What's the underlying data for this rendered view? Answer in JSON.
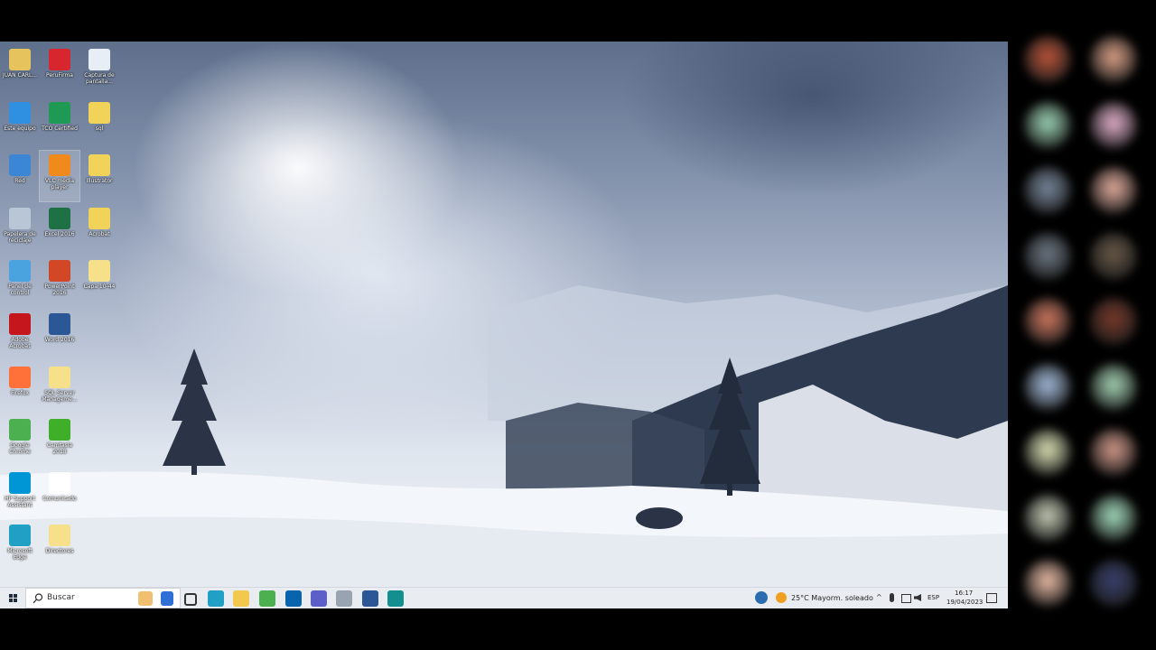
{
  "desktop": {
    "icons": [
      {
        "label": "JUAN CARL...",
        "icon": "user-folder-icon",
        "color": "#e6c35c"
      },
      {
        "label": "PeruFirma",
        "icon": "perufirma-icon",
        "color": "#d7262e"
      },
      {
        "label": "Captura de pantalla...",
        "icon": "screenshot-file-icon",
        "color": "#e8eef5"
      },
      {
        "label": "Este equipo",
        "icon": "this-pc-icon",
        "color": "#2f8fe0"
      },
      {
        "label": "TCO Certified",
        "icon": "tco-certified-icon",
        "color": "#1f9a55"
      },
      {
        "label": "sql",
        "icon": "archive-icon",
        "color": "#f2d35a"
      },
      {
        "label": "Red",
        "icon": "network-icon",
        "color": "#3c86d6"
      },
      {
        "label": "VLC media player",
        "icon": "vlc-icon",
        "color": "#f08a1c"
      },
      {
        "label": "Illustrator",
        "icon": "archive-icon",
        "color": "#f2d35a"
      },
      {
        "label": "Papelera de reciclaje",
        "icon": "recycle-bin-icon",
        "color": "#b9c6d6"
      },
      {
        "label": "Excel 2016",
        "icon": "excel-icon",
        "color": "#1e7145"
      },
      {
        "label": "Acrobat",
        "icon": "archive-icon",
        "color": "#f2d35a"
      },
      {
        "label": "Panel de control",
        "icon": "control-panel-icon",
        "color": "#4aa3df"
      },
      {
        "label": "PowerPoint 2016",
        "icon": "powerpoint-icon",
        "color": "#d24726"
      },
      {
        "label": "Capa 10-44",
        "icon": "folder-icon",
        "color": "#f7e08a"
      },
      {
        "label": "Adobe Acrobat",
        "icon": "acrobat-icon",
        "color": "#c4161c"
      },
      {
        "label": "Word 2016",
        "icon": "word-icon",
        "color": "#2b5797"
      },
      {
        "label": "Firefox",
        "icon": "firefox-icon",
        "color": "#ff7139"
      },
      {
        "label": "SQL Server Manageme...",
        "icon": "folder-icon",
        "color": "#f7e08a"
      },
      {
        "label": "Google Chrome",
        "icon": "chrome-icon",
        "color": "#4caf50"
      },
      {
        "label": "Camtasia 2018",
        "icon": "camtasia-icon",
        "color": "#3fae29"
      },
      {
        "label": "HP Support Assistant",
        "icon": "hp-support-icon",
        "color": "#0096d6"
      },
      {
        "label": "Comunicado",
        "icon": "document-icon",
        "color": "#ffffff"
      },
      {
        "label": "Microsoft Edge",
        "icon": "edge-icon",
        "color": "#1fa0c4"
      },
      {
        "label": "Directores",
        "icon": "folder-icon",
        "color": "#f7e08a"
      }
    ]
  },
  "taskbar": {
    "search_placeholder": "Buscar",
    "weather": "25°C  Mayorm. soleado",
    "language": "ESP",
    "time": "16:17",
    "date": "19/04/2023",
    "apps": [
      {
        "name": "task-view-icon",
        "color": "#333333"
      },
      {
        "name": "edge-icon",
        "color": "#1fa0c4"
      },
      {
        "name": "file-explorer-icon",
        "color": "#f2c94c"
      },
      {
        "name": "chrome-icon",
        "color": "#4caf50"
      },
      {
        "name": "outlook-icon",
        "color": "#0a64ad"
      },
      {
        "name": "teams-icon",
        "color": "#5b5fc7"
      },
      {
        "name": "snipping-tool-icon",
        "color": "#9aa4b1"
      },
      {
        "name": "word-icon",
        "color": "#2b5797"
      },
      {
        "name": "sway-icon",
        "color": "#138f8f"
      }
    ]
  },
  "participants": [
    "#c0563a",
    "#e0a48a",
    "#9ed8b8",
    "#e8b4d0",
    "#7a8aa0",
    "#e8b0a0",
    "#6f7b88",
    "#6b5b4a",
    "#d47a60",
    "#7a3a2a",
    "#a6bfe0",
    "#a8d8b8",
    "#e0e6b8",
    "#d89c8c",
    "#c8d0b8",
    "#a6e0c0",
    "#f0c0a8",
    "#3a4270"
  ]
}
